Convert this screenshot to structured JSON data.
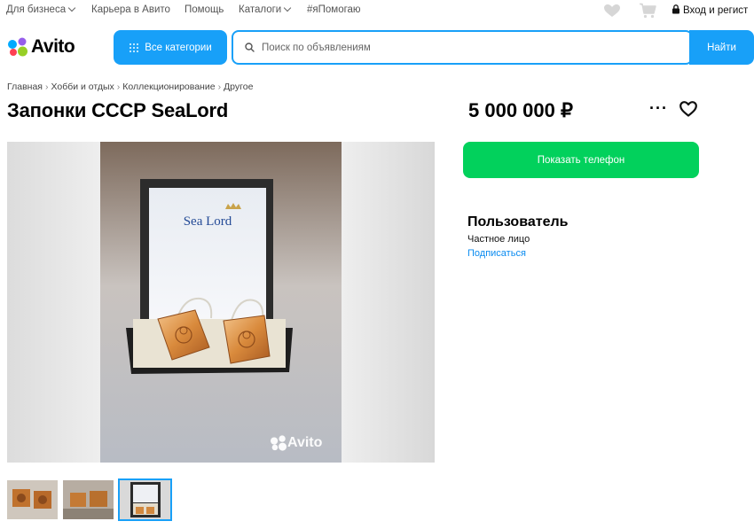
{
  "topnav": {
    "items": [
      "Для бизнеса",
      "Карьера в Авито",
      "Помощь",
      "Каталоги",
      "#яПомогаю"
    ],
    "login": "Вход и регист"
  },
  "header": {
    "logo_text": "Avito",
    "categories_label": "Все категории",
    "search_placeholder": "Поиск по объявлениям",
    "find_label": "Найти"
  },
  "breadcrumb": [
    "Главная",
    "Хобби и отдых",
    "Коллекционирование",
    "Другое"
  ],
  "listing": {
    "title": "Запонки СССР SeaLord",
    "price": "5 000 000 ₽",
    "photo_brand": "Sea Lord",
    "watermark": "Avito",
    "active_thumbnail": 3
  },
  "contact": {
    "phone_button": "Показать телефон"
  },
  "seller": {
    "name": "Пользователь",
    "type": "Частное лицо",
    "subscribe": "Подписаться"
  },
  "colors": {
    "accent_blue": "#18a0f8",
    "green": "#02d15c",
    "link_blue": "#0a8bf0"
  }
}
